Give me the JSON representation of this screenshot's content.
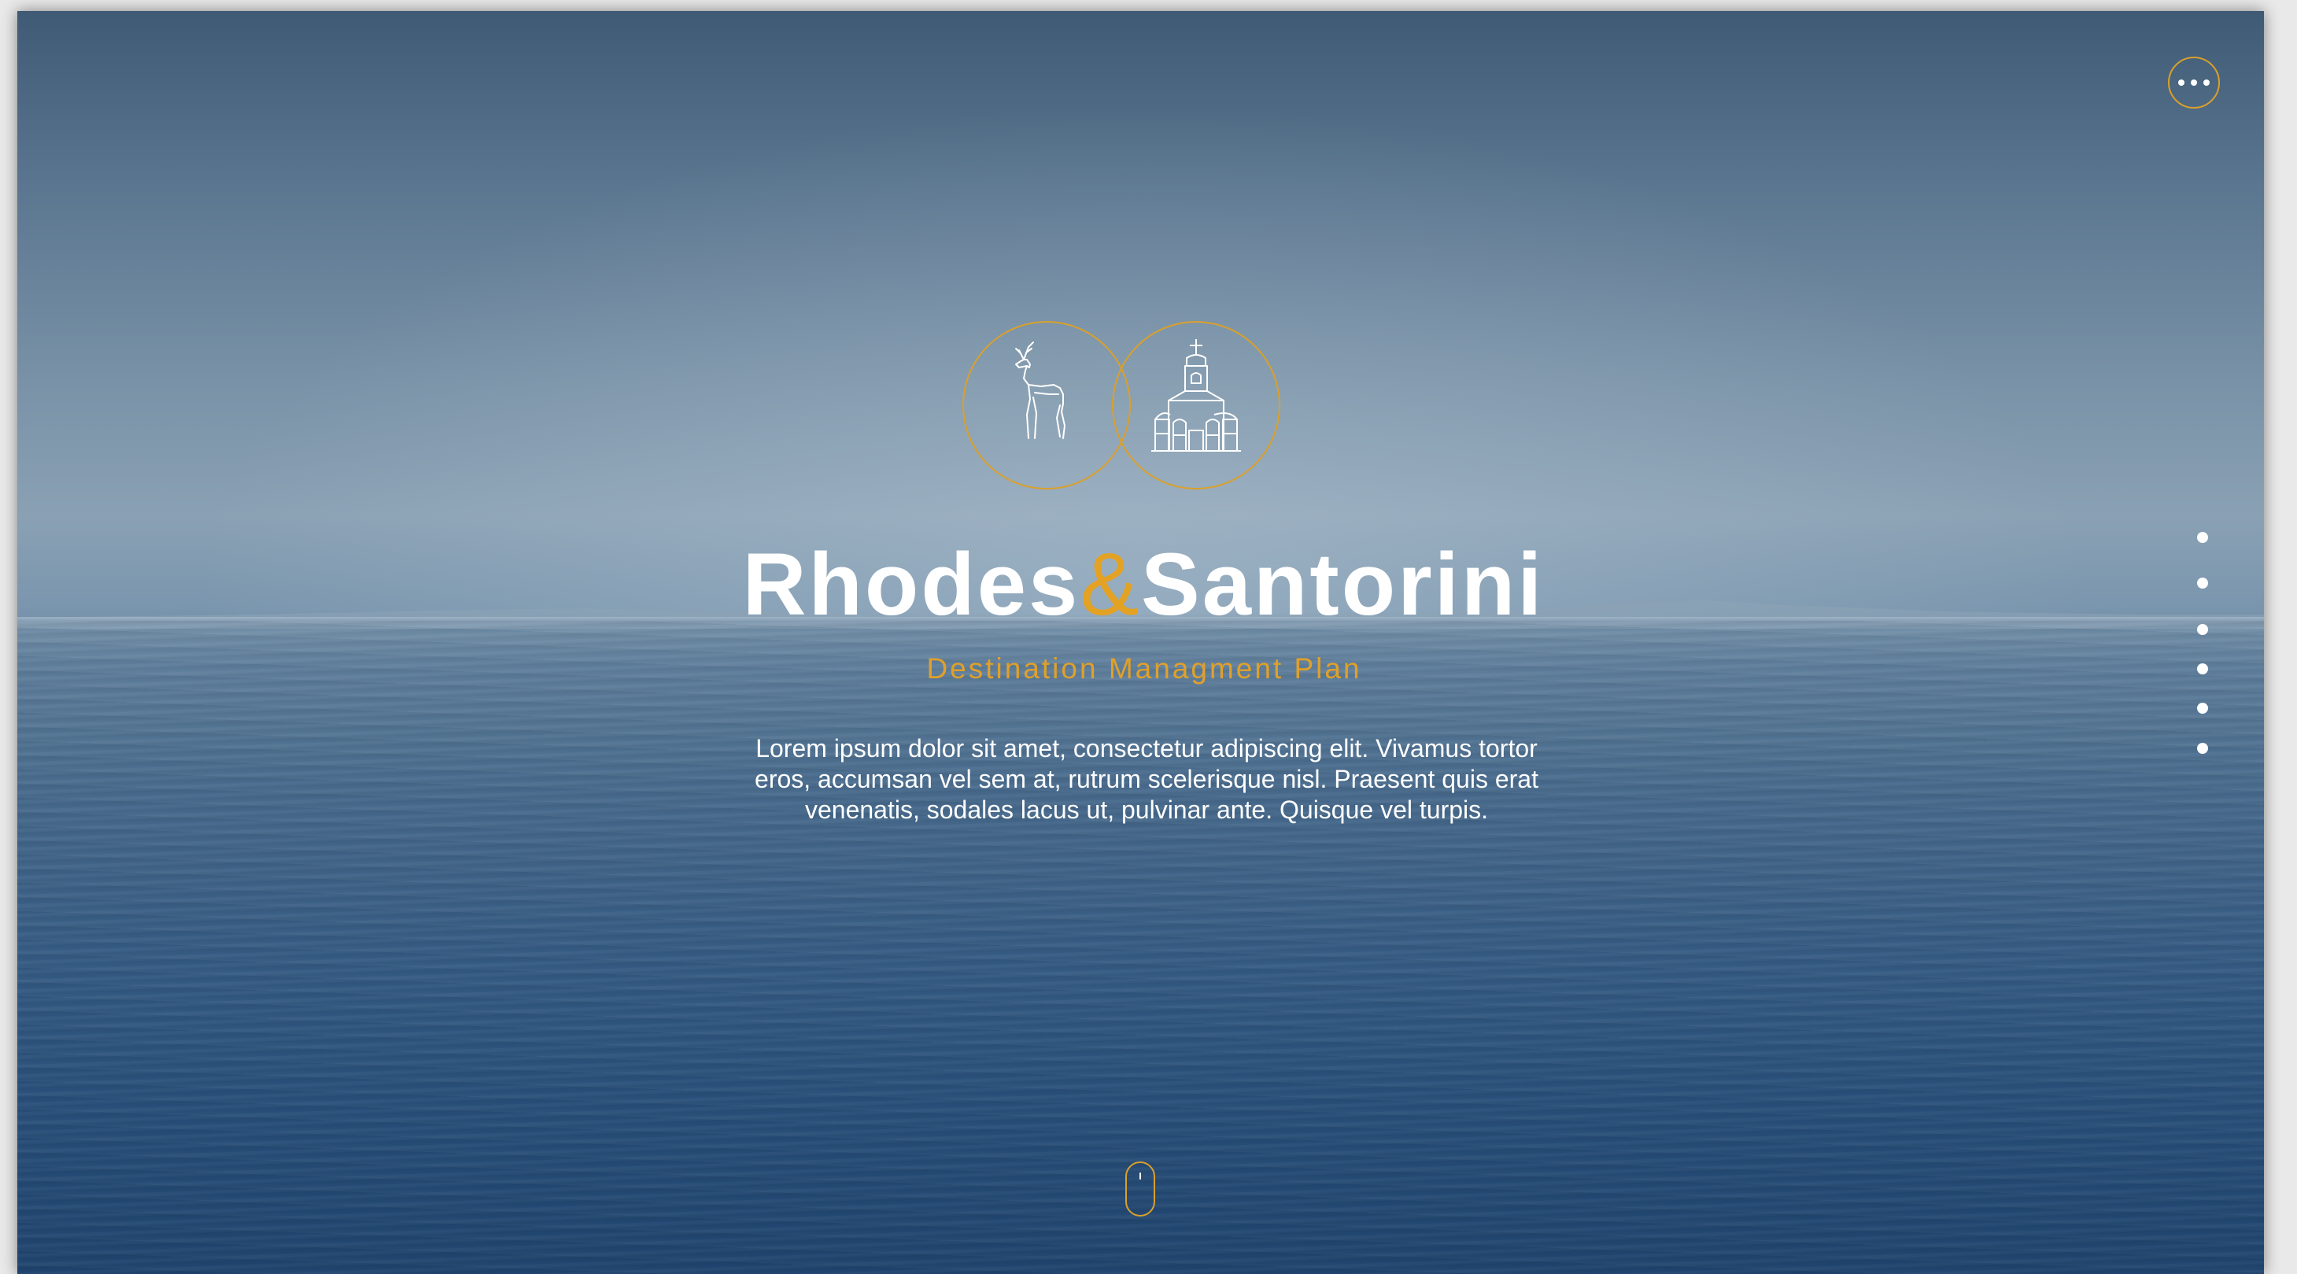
{
  "hero": {
    "title_part1": "Rhodes",
    "title_amp": "&",
    "title_part2": "Santorini",
    "subtitle": "Destination Managment Plan",
    "description": "Lorem ipsum dolor sit amet, consectetur adipiscing elit. Vivamus tortor eros, accumsan vel sem at, rutrum scelerisque nisl. Praesent quis erat venenatis, sodales lacus ut, pulvinar ante. Quisque vel turpis."
  },
  "logo": {
    "icons": [
      "deer-icon",
      "church-icon"
    ]
  },
  "nav": {
    "dots_count": 6
  },
  "colors": {
    "accent": "#e0a02a",
    "text": "#ffffff",
    "sea_top": "#3f5a74",
    "sea_bottom": "#234b77"
  }
}
